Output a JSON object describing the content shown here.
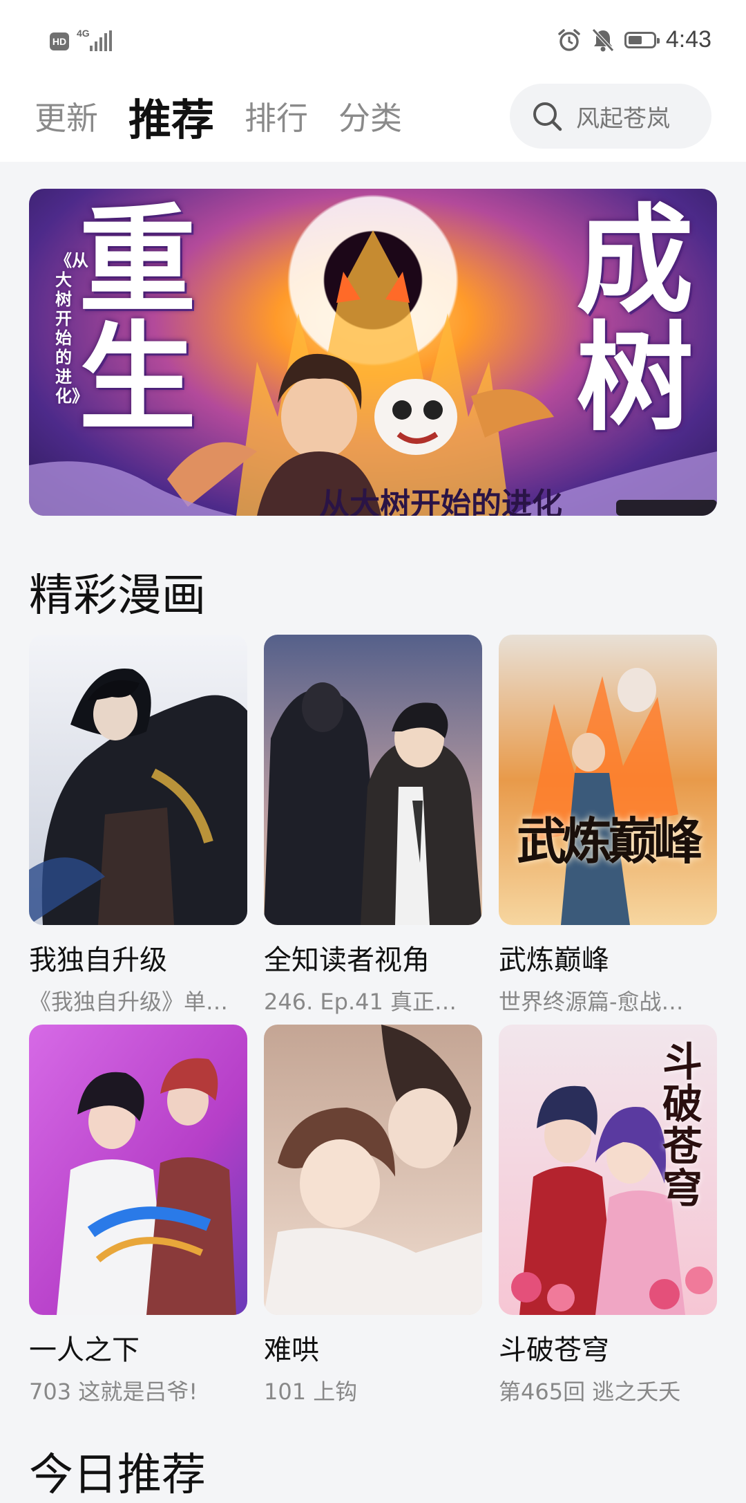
{
  "status_bar": {
    "hd_badge": "HD",
    "network": "4G",
    "time": "4:43",
    "battery_level": 0.55,
    "icons": [
      "alarm-icon",
      "bell-off-icon",
      "battery-icon"
    ]
  },
  "header": {
    "tabs": [
      {
        "label": "更新",
        "active": false
      },
      {
        "label": "推荐",
        "active": true
      },
      {
        "label": "排行",
        "active": false
      },
      {
        "label": "分类",
        "active": false
      }
    ],
    "search_placeholder": "风起苍岚"
  },
  "banner": {
    "title_left": "重生",
    "title_right": "成树",
    "subtitle": "《从大树开始的进化》",
    "strip_text": "从大树开始的进化"
  },
  "sections": {
    "featured_title": "精彩漫画",
    "today_title": "今日推荐"
  },
  "comics": [
    {
      "title": "我独自升级",
      "subtitle": "《我独自升级》单…"
    },
    {
      "title": "全知读者视角",
      "subtitle": "246. Ep.41 真正…"
    },
    {
      "title": "武炼巅峰",
      "subtitle": "世界终源篇-愈战…",
      "cover_text": "武炼巅峰"
    },
    {
      "title": "一人之下",
      "subtitle": "703 这就是吕爷!"
    },
    {
      "title": "难哄",
      "subtitle": "101 上钩"
    },
    {
      "title": "斗破苍穹",
      "subtitle": "第465回 逃之夭夭",
      "cover_text": "斗破苍穹"
    }
  ],
  "colors": {
    "background": "#f4f5f7",
    "header_bg": "#ffffff",
    "active_tab": "#111111",
    "inactive_tab": "#8a8a8a"
  }
}
